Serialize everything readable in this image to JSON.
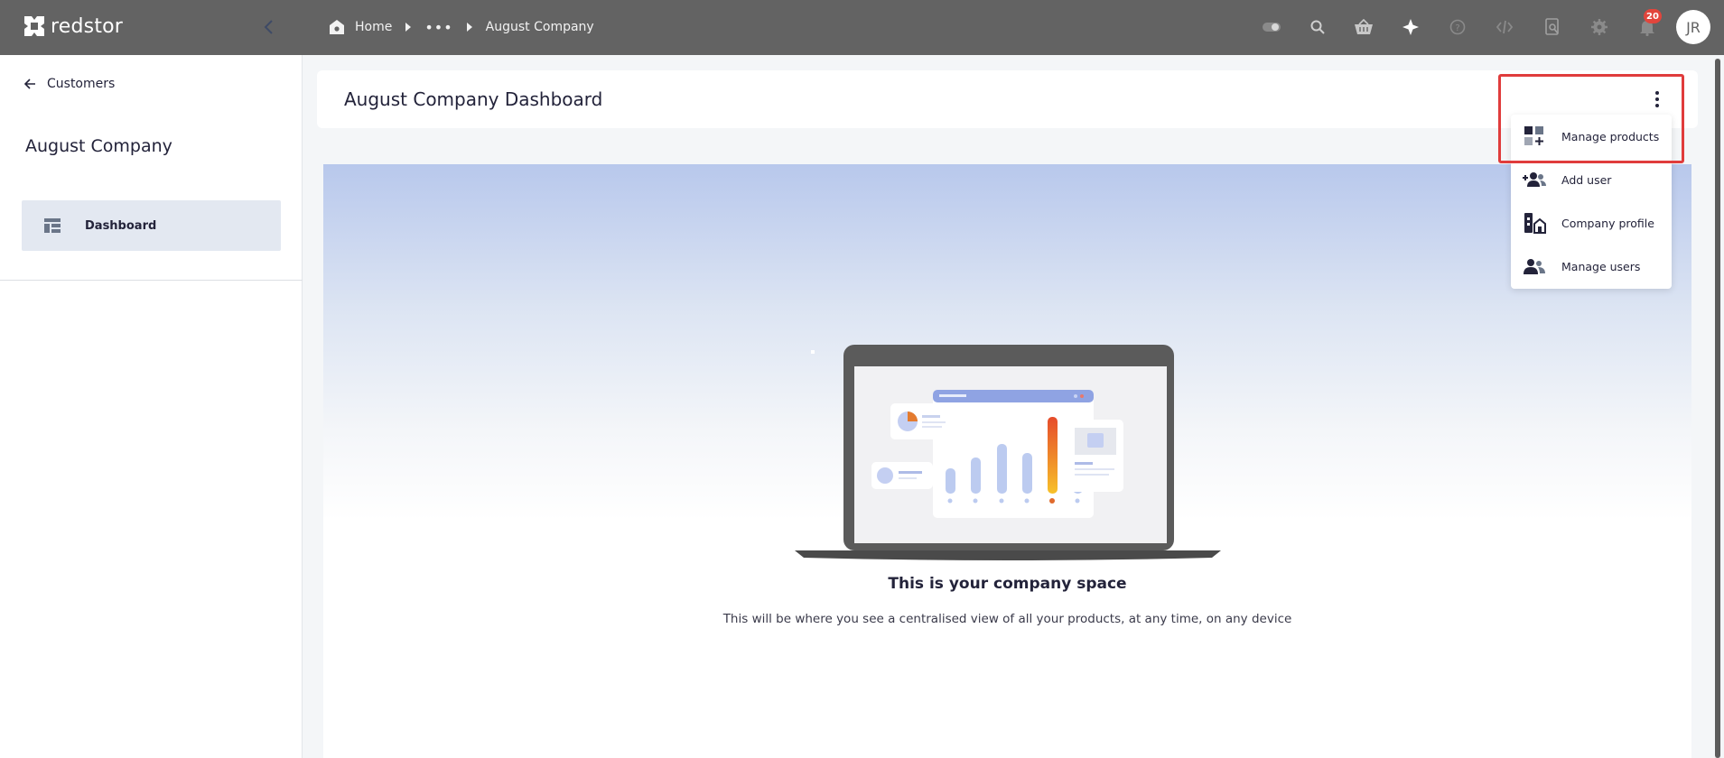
{
  "app": {
    "brand": "redstor"
  },
  "breadcrumb": {
    "home": "Home",
    "ellipsis": "•••",
    "current": "August Company"
  },
  "topbar": {
    "tools": [
      "toggle-icon",
      "search-icon",
      "basket-icon",
      "sparkle-icon",
      "help-icon",
      "code-icon",
      "search-doc-icon",
      "gear-icon",
      "bell-icon"
    ],
    "notifications_count": "20",
    "avatar_initials": "JR"
  },
  "sidebar": {
    "back_label": "Customers",
    "company_name": "August Company",
    "items": [
      {
        "label": "Dashboard",
        "icon": "dashboard-icon",
        "active": true
      }
    ]
  },
  "header": {
    "title": "August Company Dashboard"
  },
  "menu": {
    "items": [
      {
        "label": "Manage products",
        "icon": "manage-products-icon"
      },
      {
        "label": "Add user",
        "icon": "add-user-icon"
      },
      {
        "label": "Company profile",
        "icon": "company-profile-icon"
      },
      {
        "label": "Manage users",
        "icon": "manage-users-icon"
      }
    ]
  },
  "empty_state": {
    "title": "This is your company space",
    "subtitle": "This will be where you see a centralised view of all your products, at any time, on any device"
  },
  "colors": {
    "topbar": "#636363",
    "accent_red": "#e03c3c",
    "nav_active": "#e3e8f1",
    "text": "#23233a"
  }
}
